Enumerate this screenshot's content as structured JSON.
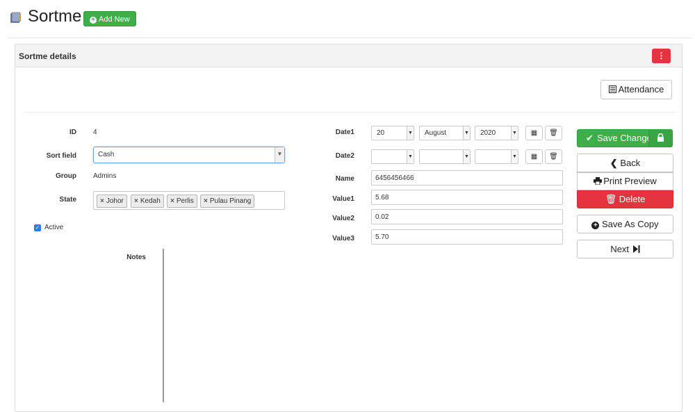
{
  "header": {
    "title": "Sortme",
    "add_new": "Add New"
  },
  "panel": {
    "title": "Sortme details",
    "attendance": "Attendance"
  },
  "form": {
    "id_label": "ID",
    "id_value": "4",
    "sort_label": "Sort field",
    "sort_value": "Cash",
    "group_label": "Group",
    "group_value": "Admins",
    "state_label": "State",
    "states": [
      "Johor",
      "Kedah",
      "Perlis",
      "Pulau Pinang"
    ],
    "active_label": "Active",
    "active_checked": true,
    "notes_label": "Notes",
    "date1_label": "Date1",
    "date1_day": "20",
    "date1_month": "August",
    "date1_year": "2020",
    "date2_label": "Date2",
    "date2_day": "",
    "date2_month": "",
    "date2_year": "",
    "name_label": "Name",
    "name_value": "6456456466",
    "value1_label": "Value1",
    "value1": "5.68",
    "value2_label": "Value2",
    "value2": "0.02",
    "value3_label": "Value3",
    "value3": "5.70"
  },
  "actions": {
    "save": "Save Changes",
    "back": "Back",
    "print": "Print Preview",
    "delete": "Delete",
    "save_copy": "Save As Copy",
    "next": "Next"
  },
  "icons": [
    "app-icon",
    "plus-circle-icon",
    "kebab-icon",
    "list-icon",
    "calendar-grid-icon",
    "trash-icon",
    "check-icon",
    "lock-icon",
    "chevron-left-icon",
    "printer-icon",
    "plus-circle-icon",
    "step-forward-icon"
  ],
  "colors": {
    "green": "#3fae49",
    "red": "#e3343f",
    "focus_blue": "#6f9fdc"
  }
}
